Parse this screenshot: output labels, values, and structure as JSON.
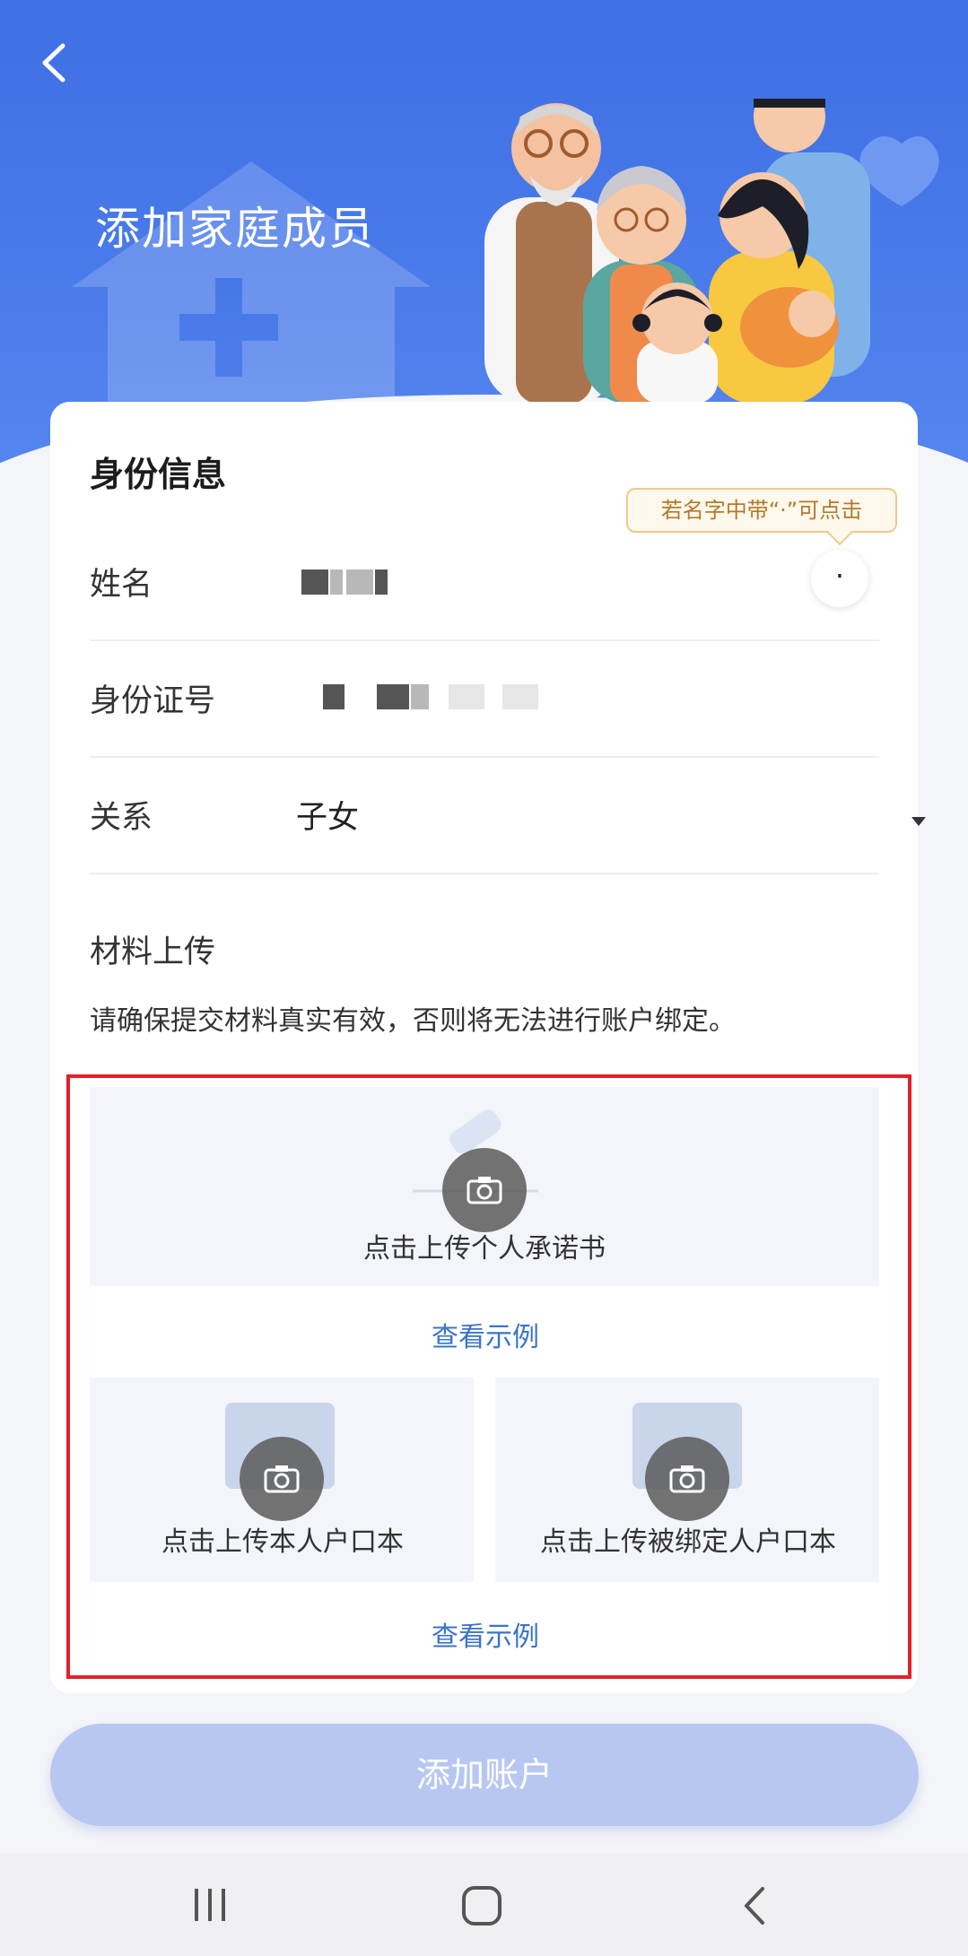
{
  "header": {
    "title": "添加家庭成员"
  },
  "card": {
    "section_title": "身份信息",
    "tooltip": "若名字中带“·”可点击",
    "dot_button": "·",
    "fields": {
      "name": {
        "label": "姓名"
      },
      "id_number": {
        "label": "身份证号"
      },
      "relation": {
        "label": "关系",
        "value": "子女"
      }
    },
    "upload": {
      "title": "材料上传",
      "hint": "请确保提交材料真实有效，否则将无法进行账户绑定。",
      "commitment_label": "点击上传个人承诺书",
      "example_1": "查看示例",
      "own_hukou_label": "点击上传本人户口本",
      "bound_hukou_label": "点击上传被绑定人户口本",
      "example_2": "查看示例"
    }
  },
  "add_button": "添加账户",
  "colors": {
    "header_blue": "#3e6fe4",
    "highlight_red": "#e2202b",
    "link_blue": "#3a74c9",
    "button_disabled": "#b8c7f1"
  },
  "icons": [
    "back-arrow-icon",
    "camera-icon",
    "dropdown-arrow-icon",
    "recent-apps-icon",
    "home-icon",
    "nav-back-icon"
  ]
}
